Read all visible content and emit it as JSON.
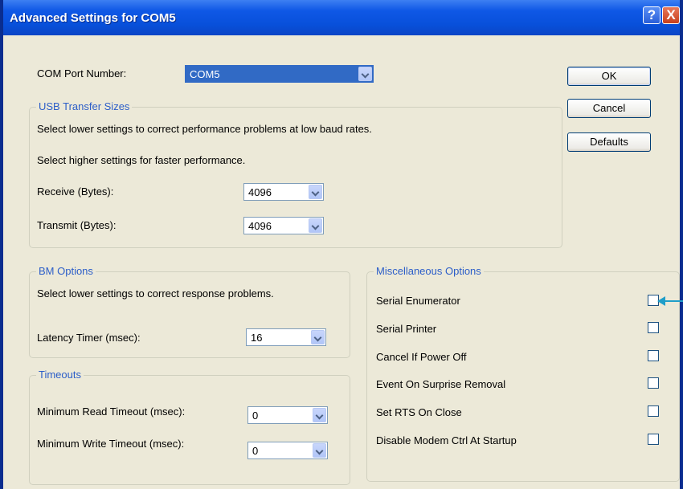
{
  "window": {
    "title": "Advanced Settings for COM5",
    "help_glyph": "?",
    "close_glyph": "X"
  },
  "com_port": {
    "label": "COM Port Number:",
    "value": "COM5"
  },
  "usb": {
    "legend": "USB Transfer Sizes",
    "desc1": "Select lower settings to correct performance problems at low baud rates.",
    "desc2": "Select higher settings for faster performance.",
    "receive_label": "Receive (Bytes):",
    "receive_value": "4096",
    "transmit_label": "Transmit (Bytes):",
    "transmit_value": "4096"
  },
  "bm": {
    "legend": "BM Options",
    "desc": "Select lower settings to correct response problems.",
    "latency_label": "Latency Timer (msec):",
    "latency_value": "16"
  },
  "timeouts": {
    "legend": "Timeouts",
    "read_label": "Minimum Read Timeout (msec):",
    "read_value": "0",
    "write_label": "Minimum Write Timeout (msec):",
    "write_value": "0"
  },
  "misc": {
    "legend": "Miscellaneous Options",
    "options": [
      {
        "label": "Serial Enumerator",
        "checked": false
      },
      {
        "label": "Serial Printer",
        "checked": false
      },
      {
        "label": "Cancel If Power Off",
        "checked": false
      },
      {
        "label": "Event On Surprise Removal",
        "checked": false
      },
      {
        "label": "Set RTS On Close",
        "checked": false
      },
      {
        "label": "Disable Modem Ctrl At Startup",
        "checked": false
      }
    ]
  },
  "buttons": {
    "ok": "OK",
    "cancel": "Cancel",
    "defaults": "Defaults"
  },
  "colors": {
    "titlebar": "#0850da",
    "group_legend": "#2c5ec8",
    "dialog_bg": "#ece9d8",
    "pointer_arrow": "#1f9ec9"
  }
}
